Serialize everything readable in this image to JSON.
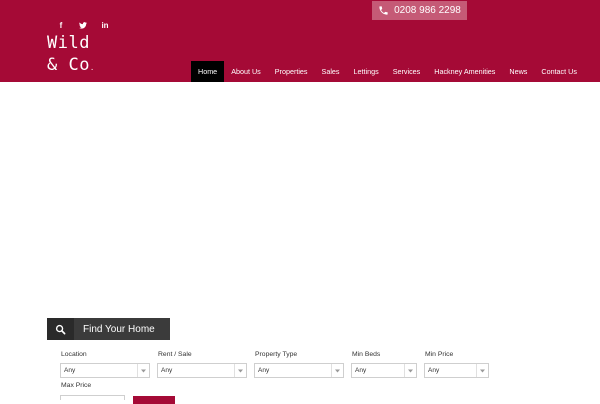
{
  "social": {
    "facebook": "f",
    "twitter": "t",
    "linkedin": "in"
  },
  "logo": {
    "line1": "Wild",
    "line2": "& Co",
    "dot": "."
  },
  "phone": {
    "number": "0208 986 2298",
    "icon": "phone-icon"
  },
  "nav": {
    "items": [
      "Home",
      "About Us",
      "Properties",
      "Sales",
      "Lettings",
      "Services",
      "Hackney Amenities",
      "News",
      "Contact Us"
    ],
    "active": "Home"
  },
  "search": {
    "title": "Find Your Home",
    "icon": "search-icon",
    "fields": {
      "location": {
        "label": "Location",
        "value": "Any"
      },
      "rent_sale": {
        "label": "Rent / Sale",
        "value": "Any"
      },
      "property_type": {
        "label": "Property Type",
        "value": "Any"
      },
      "min_beds": {
        "label": "Min Beds",
        "value": "Any"
      },
      "min_price": {
        "label": "Min Price",
        "value": "Any"
      },
      "max_price": {
        "label": "Max Price"
      }
    }
  },
  "colors": {
    "brand": "#a50a36",
    "nav_active": "#000000",
    "phone_bg": "#c55a76",
    "search_tab": "#3b3b3b"
  }
}
